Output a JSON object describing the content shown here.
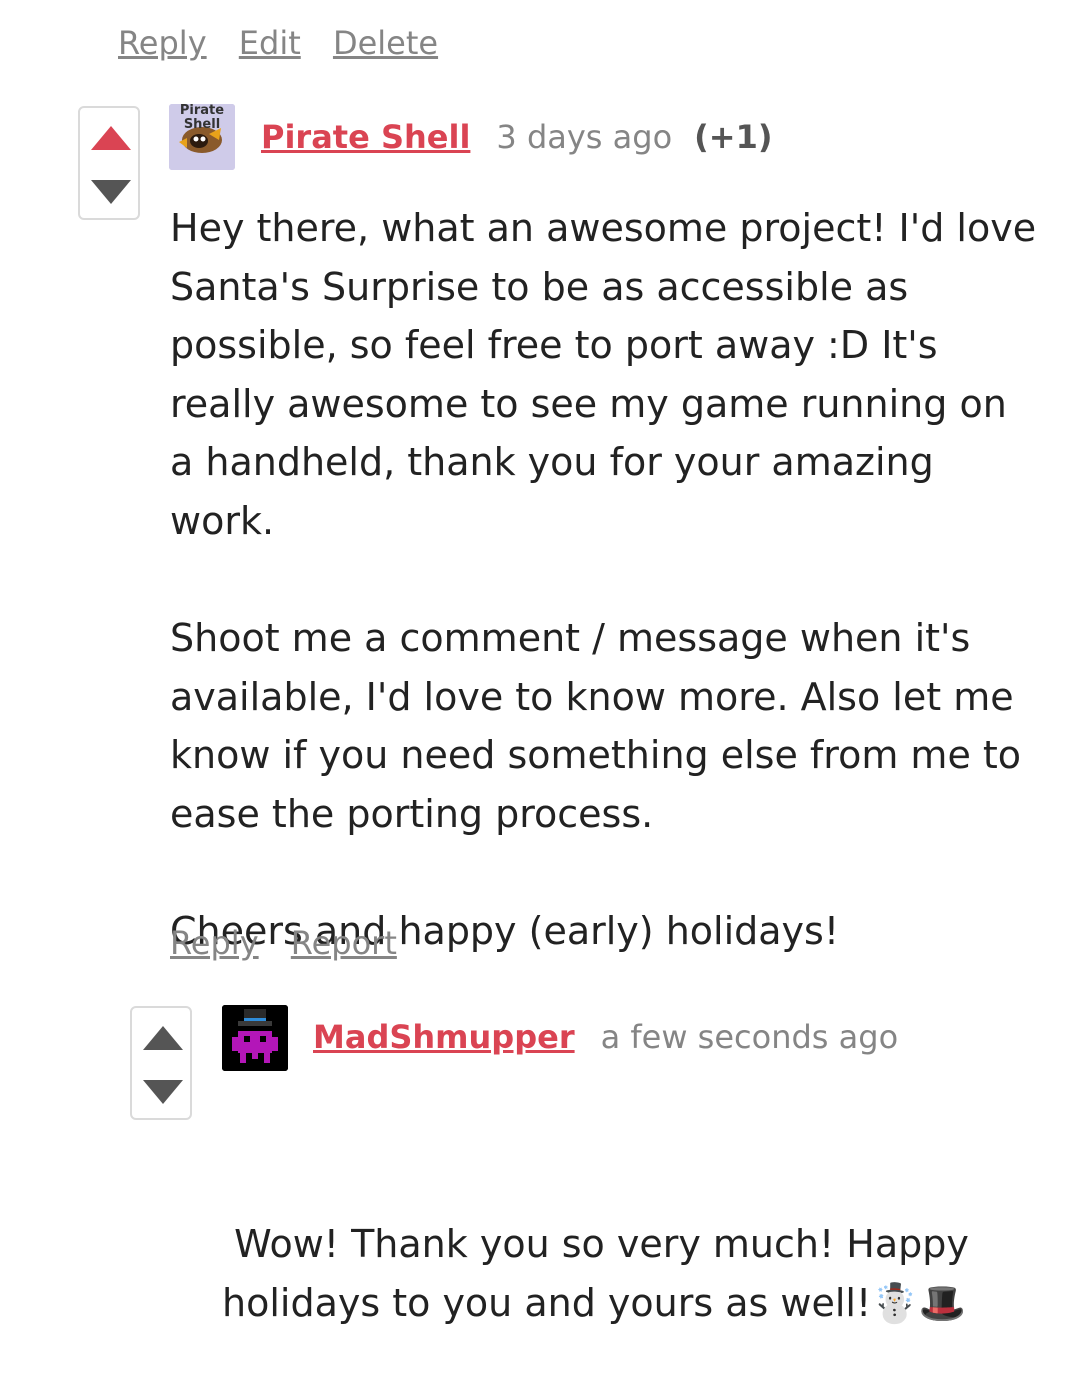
{
  "top_actions": {
    "reply": "Reply",
    "edit": "Edit",
    "delete": "Delete"
  },
  "comment1": {
    "author": "Pirate Shell",
    "avatar_text": "Pirate Shell",
    "time": "3 days ago",
    "score": "(+1)",
    "paragraphs": [
      "Hey there, what an awesome project! I'd love Santa's Surprise to be as accessible as possible, so feel free to port away :D It's really awesome to see my game running on a handheld, thank you for your amazing work.",
      "Shoot me a comment / message when it's available, I'd love to know more. Also let me know if you need something else from me to ease the porting process.",
      "Cheers and happy (early) holidays!"
    ],
    "reply": "Reply",
    "report": "Report"
  },
  "comment2": {
    "author": "MadShmupper",
    "time": "a few seconds ago",
    "body": " Wow! Thank you so very much! Happy holidays to you and yours as well!☃️🎩"
  },
  "colors": {
    "accent": "#da4453",
    "muted": "#858585",
    "text": "#222222"
  }
}
